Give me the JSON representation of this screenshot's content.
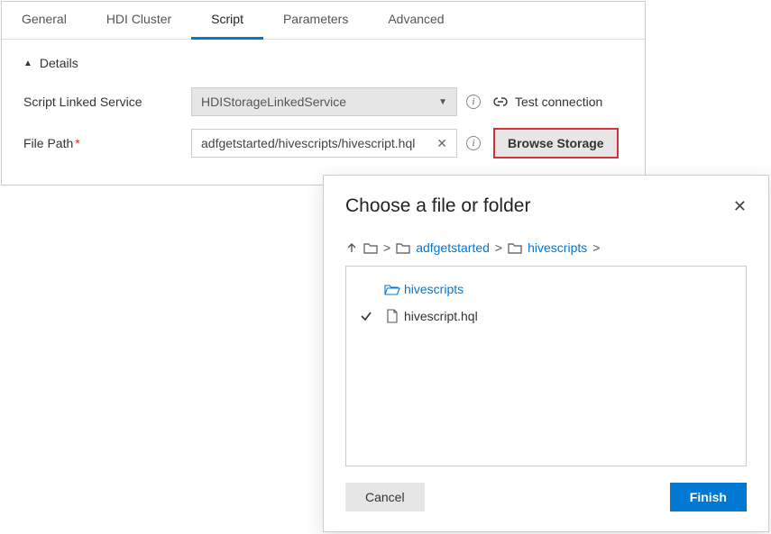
{
  "tabs": {
    "general": "General",
    "hdi": "HDI Cluster",
    "script": "Script",
    "parameters": "Parameters",
    "advanced": "Advanced"
  },
  "details": {
    "header": "Details",
    "scriptLinkedLabel": "Script Linked Service",
    "scriptLinkedValue": "HDIStorageLinkedService",
    "testConnection": "Test connection",
    "filePathLabel": "File Path",
    "filePathValue": "adfgetstarted/hivescripts/hivescript.hql",
    "browseStorage": "Browse Storage"
  },
  "dialog": {
    "title": "Choose a file or folder",
    "bc1": "adfgetstarted",
    "bc2": "hivescripts",
    "folderName": "hivescripts",
    "fileName": "hivescript.hql",
    "cancel": "Cancel",
    "finish": "Finish"
  }
}
